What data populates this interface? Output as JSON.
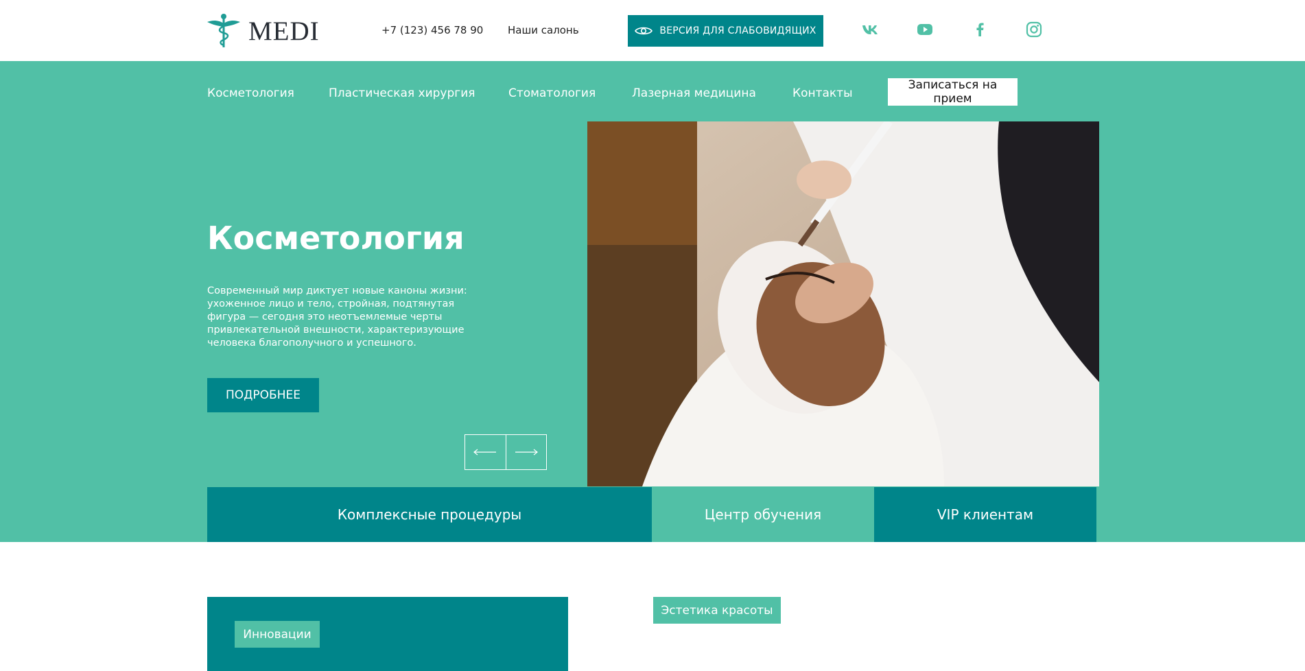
{
  "header": {
    "logo_text": "MEDI",
    "phone": "+7 (123) 456 78 90",
    "salons_label": "Наши салоны",
    "accessibility_label": "ВЕРСИЯ ДЛЯ СЛАБОВИДЯЩИХ",
    "social_icons": [
      "vk-icon",
      "youtube-icon",
      "facebook-icon",
      "instagram-icon"
    ]
  },
  "nav": {
    "items": [
      {
        "label": "Косметология"
      },
      {
        "label": "Пластическая хирургия"
      },
      {
        "label": "Стоматология"
      },
      {
        "label": "Лазерная медицина"
      },
      {
        "label": "Контакты"
      }
    ],
    "appointment_label": "Записаться на прием"
  },
  "hero": {
    "title": "Косметология",
    "description": "Современный мир диктует новые каноны жизни: ухоженное лицо и тело, стройная, подтянутая фигура — сегодня это неотъемлемые черты привлекательной внешности, характеризующие человека благополучного и успешного.",
    "more_label": "ПОДРОБНЕЕ"
  },
  "tabs": [
    {
      "label": "Комплексные процедуры"
    },
    {
      "label": "Центр обучения"
    },
    {
      "label": "VIP клиентам"
    }
  ],
  "sections": {
    "innovations_tag": "Инновации",
    "aesthetics_tag": "Эстетика красоты"
  },
  "colors": {
    "accent_teal": "#51c0a6",
    "dark_teal": "#00858a"
  }
}
